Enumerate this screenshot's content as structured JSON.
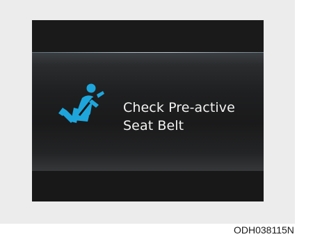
{
  "warning": {
    "icon": "seat-belt-warning-icon",
    "message_line1": "Check Pre-active",
    "message_line2": "Seat Belt"
  },
  "figure_code": "ODH038115N",
  "colors": {
    "icon": "#1ea6dc",
    "text": "#f2f2f2",
    "screen_background": "#101010",
    "frame_background": "#ececec"
  }
}
